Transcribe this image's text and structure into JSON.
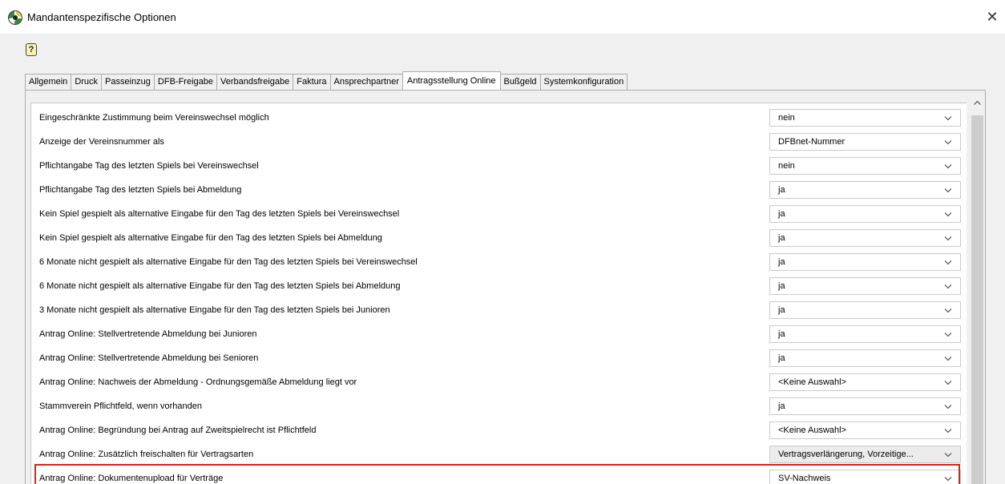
{
  "window": {
    "title": "Mandantenspezifische Optionen",
    "close_glyph": "✕",
    "help_glyph": "?",
    "app_icon": "football-icon"
  },
  "tabs": [
    {
      "label": "Allgemein",
      "active": false
    },
    {
      "label": "Druck",
      "active": false
    },
    {
      "label": "Passeinzug",
      "active": false
    },
    {
      "label": "DFB-Freigabe",
      "active": false
    },
    {
      "label": "Verbandsfreigabe",
      "active": false
    },
    {
      "label": "Faktura",
      "active": false
    },
    {
      "label": "Ansprechpartner",
      "active": false
    },
    {
      "label": "Antragsstellung Online",
      "active": true
    },
    {
      "label": "Bußgeld",
      "active": false
    },
    {
      "label": "Systemkonfiguration",
      "active": false
    }
  ],
  "options": [
    {
      "label": "Eingeschränkte Zustimmung beim Vereinswechsel möglich",
      "value": "nein"
    },
    {
      "label": "Anzeige der Vereinsnummer als",
      "value": "DFBnet-Nummer"
    },
    {
      "label": "Pflichtangabe Tag des letzten Spiels bei Vereinswechsel",
      "value": "nein"
    },
    {
      "label": "Pflichtangabe Tag des letzten Spiels bei Abmeldung",
      "value": "ja"
    },
    {
      "label": "Kein Spiel gespielt als alternative Eingabe für den Tag des letzten Spiels bei Vereinswechsel",
      "value": "ja"
    },
    {
      "label": "Kein Spiel gespielt als alternative Eingabe für den Tag des letzten Spiels bei Abmeldung",
      "value": "ja"
    },
    {
      "label": "6 Monate nicht gespielt als alternative Eingabe für den Tag des letzten Spiels bei Vereinswechsel",
      "value": "ja"
    },
    {
      "label": "6 Monate nicht gespielt als alternative Eingabe für den Tag des letzten Spiels bei Abmeldung",
      "value": "ja"
    },
    {
      "label": "3 Monate nicht gespielt als alternative Eingabe für den Tag des letzten Spiels bei Junioren",
      "value": "ja"
    },
    {
      "label": "Antrag Online: Stellvertretende Abmeldung bei Junioren",
      "value": "ja"
    },
    {
      "label": "Antrag Online: Stellvertretende Abmeldung bei Senioren",
      "value": "ja"
    },
    {
      "label": "Antrag Online: Nachweis der Abmeldung - Ordnungsgemäße Abmeldung liegt vor",
      "value": "<Keine Auswahl>"
    },
    {
      "label": "Stammverein Pflichtfeld, wenn vorhanden",
      "value": "ja"
    },
    {
      "label": "Antrag Online: Begründung bei Antrag auf Zweitspielrecht ist Pflichtfeld",
      "value": "<Keine Auswahl>"
    },
    {
      "label": "Antrag Online: Zusätzlich freischalten für Vertragsarten",
      "value": "Vertragsverlängerung, Vorzeitige...",
      "disabled_style": true
    },
    {
      "label": "Antrag Online: Dokumentenupload für Verträge",
      "value": "SV-Nachweis",
      "highlighted": true
    }
  ],
  "colors": {
    "highlight": "#e02020",
    "window_bg": "#f0f0f0"
  }
}
